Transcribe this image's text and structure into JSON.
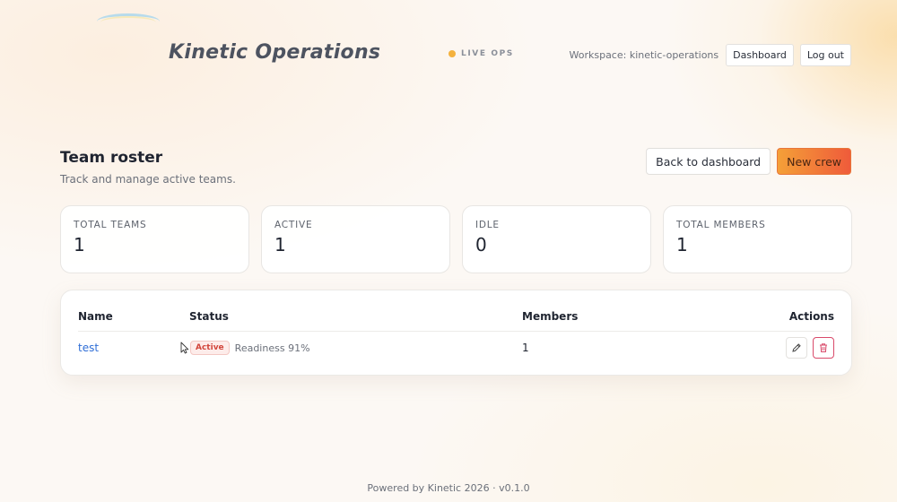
{
  "header": {
    "brand": "Kinetic Operations",
    "live_label": "LIVE OPS",
    "workspace_text": "Workspace: kinetic-operations",
    "dashboard_label": "Dashboard",
    "logout_label": "Log out"
  },
  "page": {
    "title": "Team roster",
    "subtitle": "Track and manage active teams.",
    "back_label": "Back to dashboard",
    "new_label": "New crew"
  },
  "stats": [
    {
      "label": "TOTAL TEAMS",
      "value": "1"
    },
    {
      "label": "ACTIVE",
      "value": "1"
    },
    {
      "label": "IDLE",
      "value": "0"
    },
    {
      "label": "TOTAL MEMBERS",
      "value": "1"
    }
  ],
  "table": {
    "columns": [
      "Name",
      "Status",
      "Members",
      "Actions"
    ],
    "rows": [
      {
        "name": "test",
        "status": "Active",
        "readiness": "Readiness 91%",
        "members": "1"
      }
    ]
  },
  "footer": {
    "text": "Powered by Kinetic 2026 · v0.1.0"
  },
  "colors": {
    "accent_start": "#f4a038",
    "accent_end": "#ef5b3a",
    "link": "#2f6ed6",
    "status_active": "#d2463c",
    "live_dot": "#f4b13d",
    "danger": "#d94a6a"
  },
  "icons": [
    "live-dot-icon",
    "cursor-icon",
    "pencil-icon",
    "trash-icon"
  ]
}
